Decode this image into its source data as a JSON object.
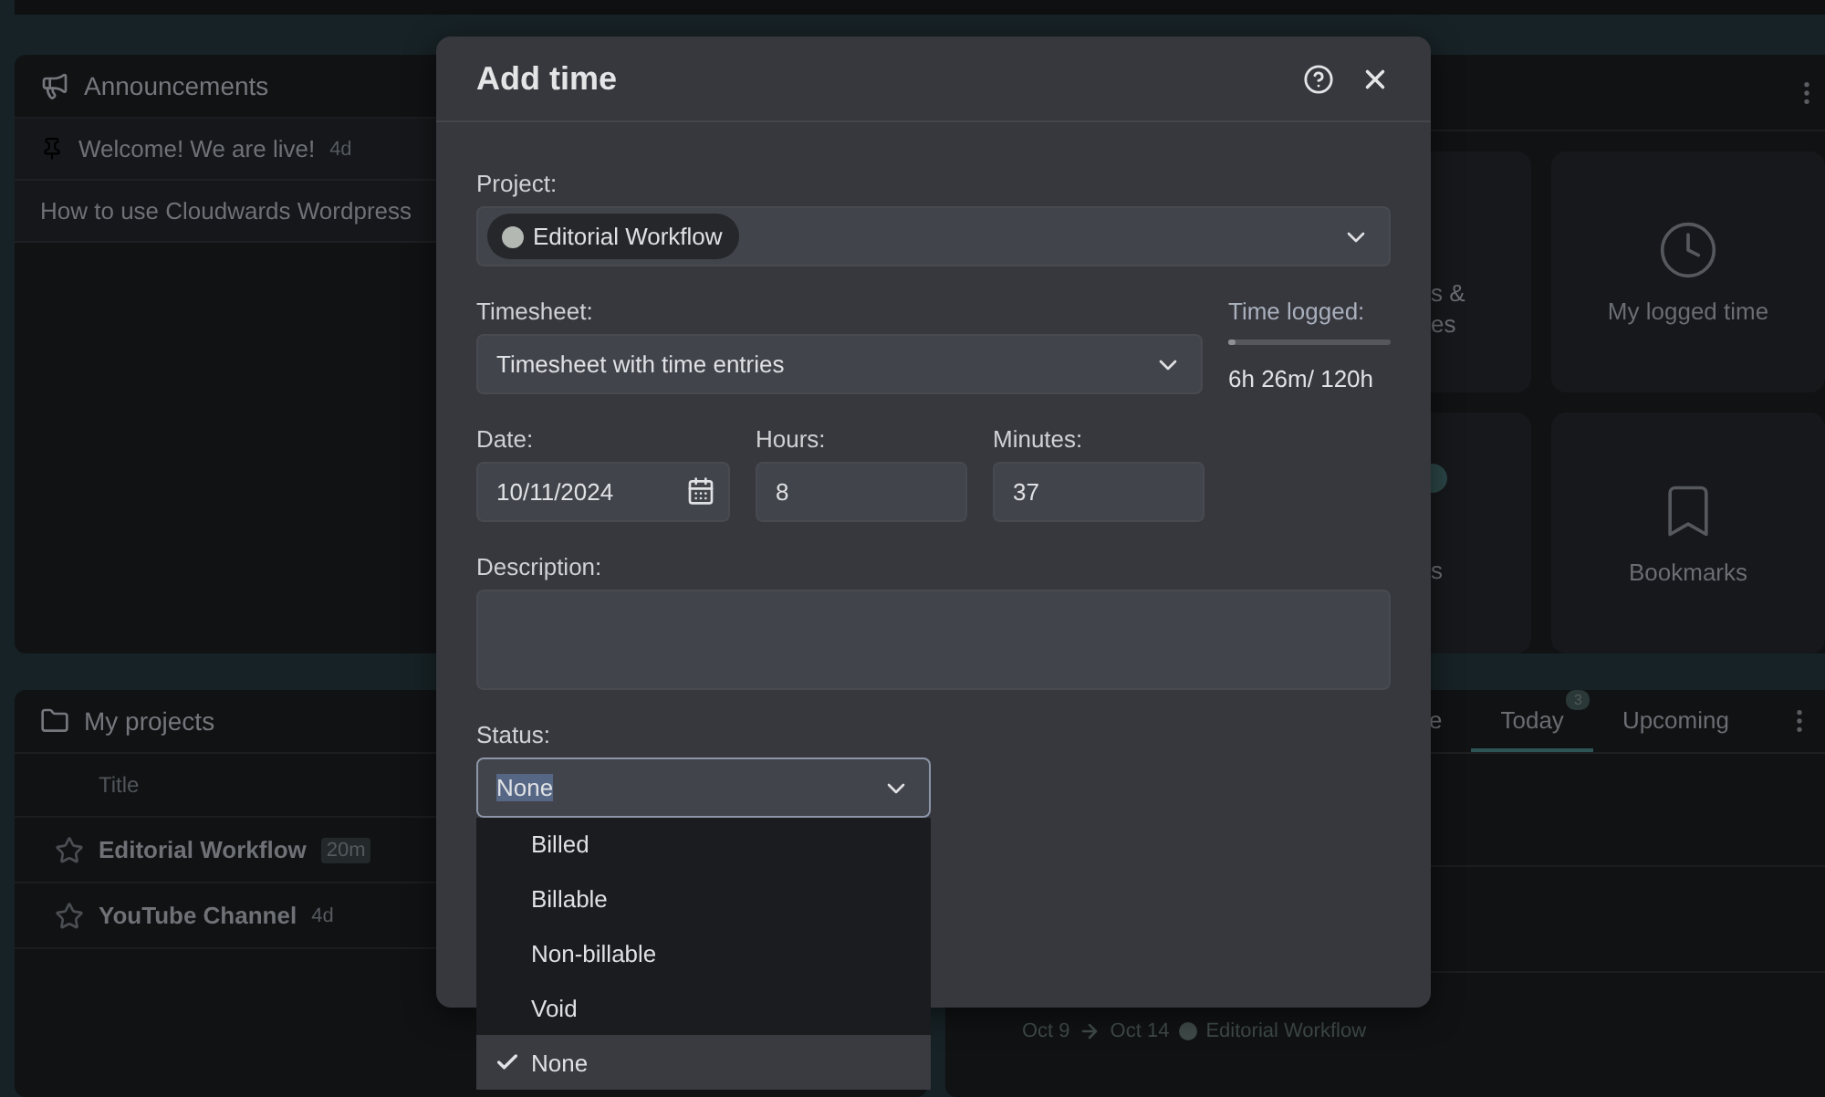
{
  "announcements": {
    "title": "Announcements",
    "items": [
      {
        "text": "Welcome! We are live!",
        "age": "4d",
        "pinned": true
      },
      {
        "text": "How to use Cloudwards Wordpress",
        "pinned": false
      }
    ]
  },
  "projects": {
    "title": "My projects",
    "column": "Title",
    "rows": [
      {
        "title": "Editorial Workflow",
        "age": "20m",
        "recent": true
      },
      {
        "title": "YouTube Channel",
        "age": "4d",
        "recent": false
      }
    ]
  },
  "shortcuts": {
    "tiles": [
      {
        "kind": "text",
        "lines": [
          "s &",
          "es"
        ],
        "badge": false
      },
      {
        "kind": "clock",
        "lines": [
          "My logged time"
        ],
        "badge": false
      },
      {
        "kind": "text",
        "lines": [
          "s"
        ],
        "badge": true
      },
      {
        "kind": "bookmark",
        "lines": [
          "Bookmarks"
        ],
        "badge": false
      }
    ]
  },
  "tasks": {
    "tabs": [
      {
        "label": "e",
        "selected": false
      },
      {
        "label": "Today",
        "selected": true,
        "count": "3"
      },
      {
        "label": "Upcoming",
        "selected": false
      }
    ],
    "entry": {
      "start": "Oct 9",
      "end": "Oct 14",
      "project": "Editorial Workflow"
    }
  },
  "dialog": {
    "title": "Add time",
    "project": {
      "label": "Project:",
      "value": "Editorial Workflow"
    },
    "timesheet": {
      "label": "Timesheet:",
      "value": "Timesheet with time entries"
    },
    "time_logged": {
      "label": "Time logged:",
      "level": 0.05,
      "reading": "6h 26m/ 120h"
    },
    "date": {
      "label": "Date:",
      "value": "10/11/2024"
    },
    "hours": {
      "label": "Hours:",
      "value": "8"
    },
    "minutes": {
      "label": "Minutes:",
      "value": "37"
    },
    "description": {
      "label": "Description:"
    },
    "status": {
      "label": "Status:",
      "value": "None",
      "open": true,
      "options": [
        {
          "label": "Billed",
          "selected": false
        },
        {
          "label": "Billable",
          "selected": false
        },
        {
          "label": "Non-billable",
          "selected": false
        },
        {
          "label": "Void",
          "selected": false
        },
        {
          "label": "None",
          "selected": true
        }
      ]
    }
  }
}
